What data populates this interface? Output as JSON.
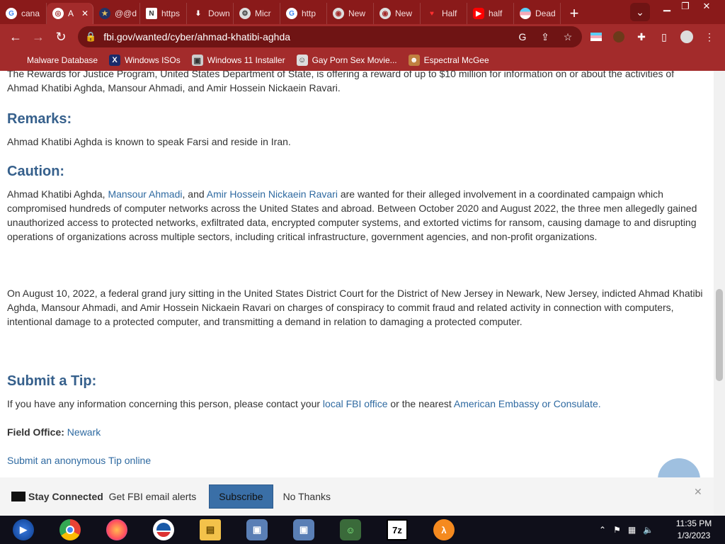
{
  "tabs": [
    {
      "label": "cana",
      "icon": "google-icon"
    },
    {
      "label": "A",
      "icon": "globe-icon",
      "active": true
    },
    {
      "label": "@@d",
      "icon": "fbi-seal-icon"
    },
    {
      "label": "https",
      "icon": "news-icon"
    },
    {
      "label": "Down",
      "icon": "download-icon"
    },
    {
      "label": "Micr",
      "icon": "settings-icon"
    },
    {
      "label": "http",
      "icon": "google-icon"
    },
    {
      "label": "New",
      "icon": "chrome-icon"
    },
    {
      "label": "New",
      "icon": "chrome-icon"
    },
    {
      "label": "Half",
      "icon": "half-icon"
    },
    {
      "label": "half",
      "icon": "youtube-icon"
    },
    {
      "label": "Dead",
      "icon": "flag-icon"
    }
  ],
  "toolbar": {
    "url": "fbi.gov/wanted/cyber/ahmad-khatibi-aghda"
  },
  "bookmarks": [
    {
      "label": "Malware Database"
    },
    {
      "label": "Windows ISOs"
    },
    {
      "label": "Windows 11 Installer"
    },
    {
      "label": "Gay Porn Sex Movie..."
    },
    {
      "label": "Espectral McGee"
    }
  ],
  "content": {
    "rewards_text": "The Rewards for Justice Program, United States Department of State, is offering a reward of up to $10 million for information on or about the activities of",
    "rewards_text2": "Ahmad Khatibi Aghda, Mansour Ahmadi, and Amir Hossein Nickaein Ravari.",
    "remarks_heading": "Remarks:",
    "remarks_text": "Ahmad Khatibi Aghda is known to speak Farsi and reside in Iran.",
    "caution_heading": "Caution:",
    "caution_pre": "Ahmad Khatibi Aghda, ",
    "caution_link1": "Mansour Ahmadi",
    "caution_mid": ", and ",
    "caution_link2": "Amir Hossein Nickaein Ravari",
    "caution_post": " are wanted for their alleged involvement in a coordinated campaign which compromised hundreds of computer networks across the United States and abroad.  Between October 2020 and August 2022, the three men allegedly gained unauthorized access to protected networks, exfiltrated data, encrypted computer systems, and extorted victims for ransom, causing damage to and disrupting operations of organizations across multiple sectors, including critical infrastructure, government agencies, and non-profit organizations.",
    "indictment_text": "On August 10, 2022, a federal grand jury sitting in the United States District Court for the District of New Jersey in Newark, New Jersey, indicted Ahmad Khatibi Aghda, Mansour Ahmadi, and Amir Hossein Nickaein Ravari on charges of conspiracy to commit fraud and related activity in connection with computers, intentional damage to a protected computer, and transmitting a demand in relation to damaging a protected computer.",
    "tip_heading": "Submit a Tip:",
    "tip_pre": "If you have any information concerning this person, please contact your ",
    "tip_link1": "local FBI office",
    "tip_mid": " or the nearest ",
    "tip_link2": "American Embassy or Consulate.",
    "field_office_label": "Field Office:",
    "field_office_value": "Newark",
    "anon_tip": "Submit an anonymous Tip online"
  },
  "stay": {
    "title": "Stay Connected",
    "text": "Get FBI email alerts",
    "subscribe": "Subscribe",
    "no_thanks": "No Thanks"
  },
  "taskbar": {
    "apps": [
      "media-center-icon",
      "chrome-icon",
      "firefox-icon",
      "obama-logo-icon",
      "file-explorer-icon",
      "computer-icon",
      "computer-icon",
      "users-icon",
      "7zip-icon",
      "half-life-icon"
    ],
    "sevenzip_label": "7z",
    "time": "11:35 PM",
    "date": "1/3/2023"
  }
}
